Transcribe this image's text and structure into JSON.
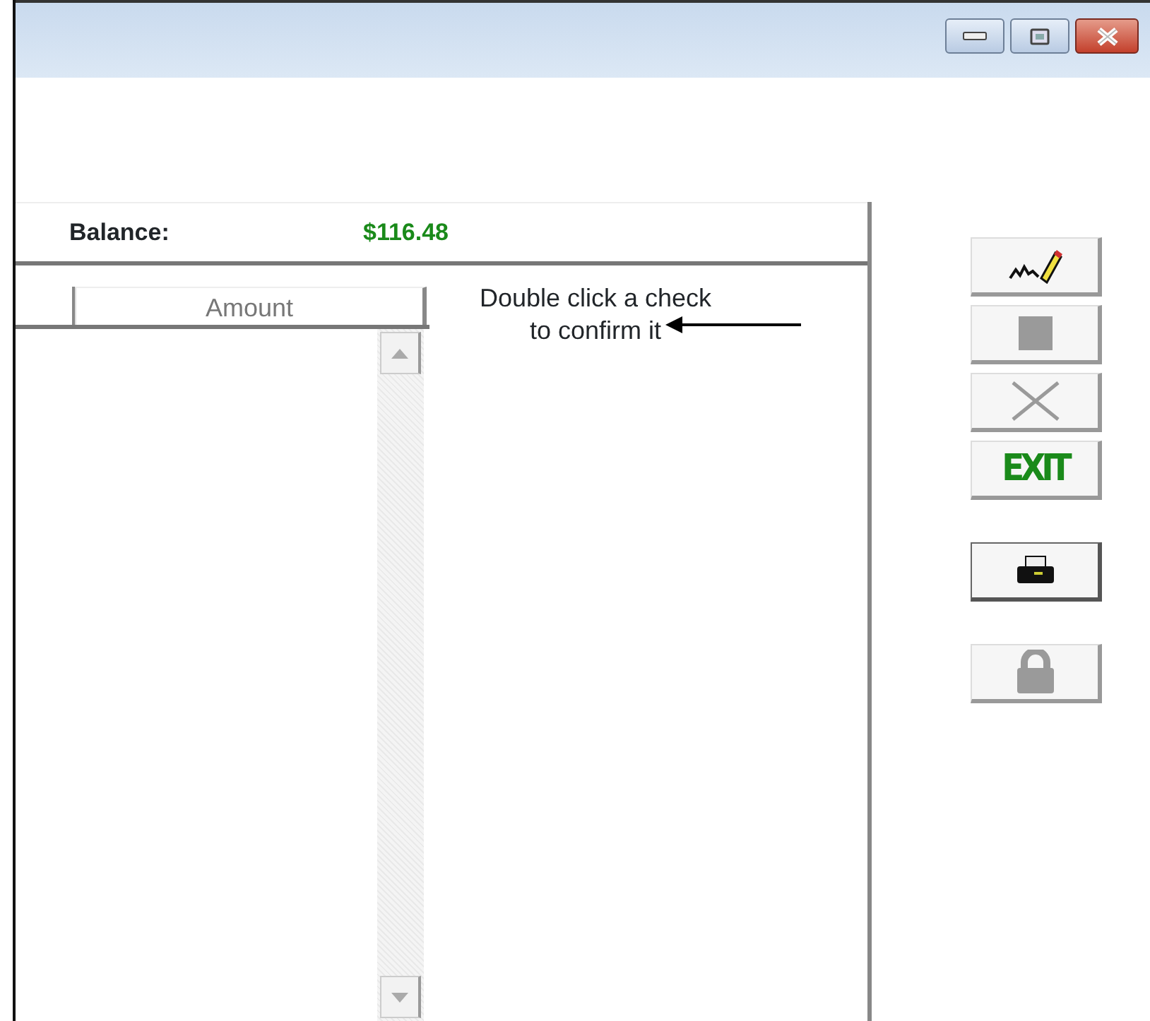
{
  "window": {
    "controls": [
      {
        "kind": "minimize"
      },
      {
        "kind": "maximize"
      },
      {
        "kind": "close"
      }
    ]
  },
  "balance": {
    "label": "Balance:",
    "value": "$116.48"
  },
  "table": {
    "columns": [
      "",
      "Amount"
    ]
  },
  "hint": {
    "text": "Double click a check to confirm it"
  },
  "toolbar": [
    {
      "kind": "sign",
      "disabled": false
    },
    {
      "kind": "stop",
      "disabled": true
    },
    {
      "kind": "cancel",
      "disabled": true
    },
    {
      "kind": "exit",
      "label": "EXIT",
      "disabled": false
    },
    {
      "kind": "print",
      "disabled": false
    },
    {
      "kind": "lock",
      "disabled": true
    }
  ]
}
